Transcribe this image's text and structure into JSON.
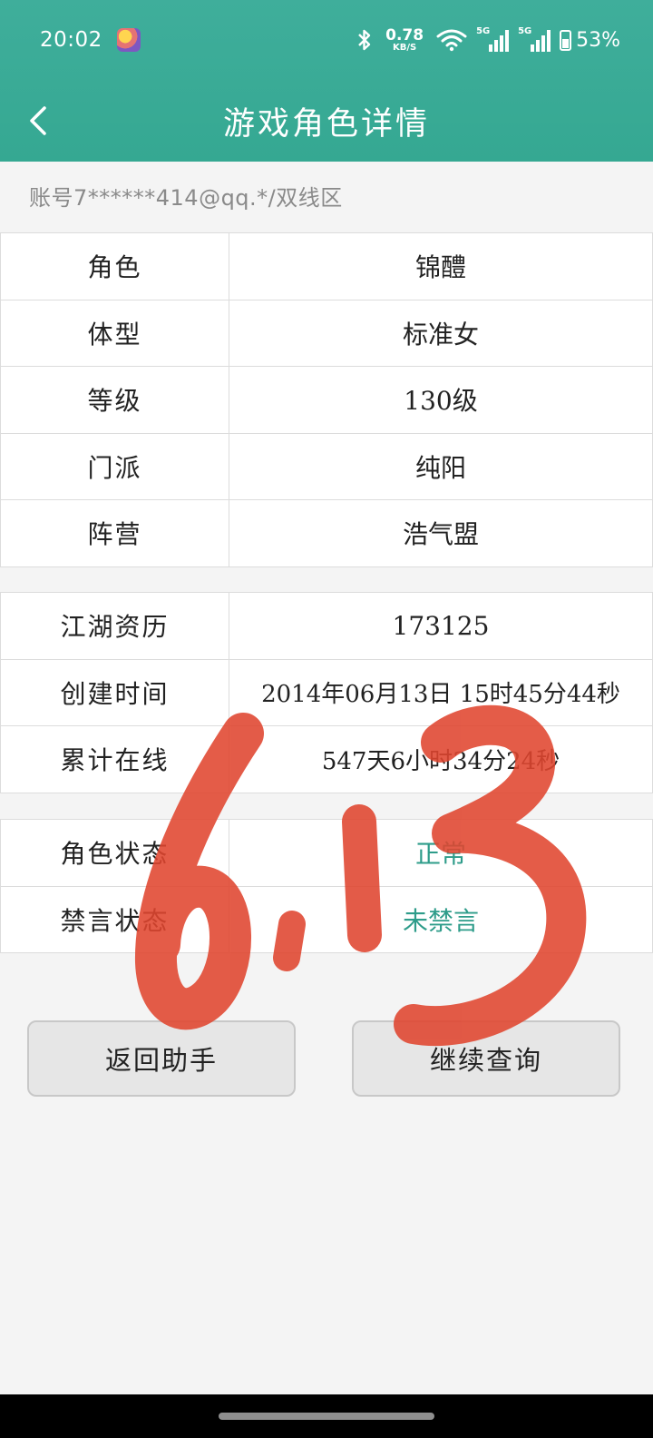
{
  "status_bar": {
    "time": "20:02",
    "speed_value": "0.78",
    "speed_unit": "KB/S",
    "signal1_tag": "5G",
    "signal2_tag": "5G",
    "battery": "53%"
  },
  "nav": {
    "title": "游戏角色详情"
  },
  "account": {
    "line": "账号7******414@qq.*/双线区"
  },
  "basic_info": [
    {
      "label": "角色",
      "value": "锦醴"
    },
    {
      "label": "体型",
      "value": "标准女"
    },
    {
      "label": "等级",
      "value": "130级"
    },
    {
      "label": "门派",
      "value": "纯阳"
    },
    {
      "label": "阵营",
      "value": "浩气盟"
    }
  ],
  "history_info": [
    {
      "label": "江湖资历",
      "value": "173125"
    },
    {
      "label": "创建时间",
      "value": "2014年06月13日 15时45分44秒"
    },
    {
      "label": "累计在线",
      "value": "547天6小时34分24秒"
    }
  ],
  "status_info": [
    {
      "label": "角色状态",
      "value": "正常"
    },
    {
      "label": "禁言状态",
      "value": "未禁言"
    }
  ],
  "buttons": {
    "back_label": "返回助手",
    "continue_label": "继续查询"
  },
  "colors": {
    "header": "#3aab96",
    "status_green": "#2e9c8a",
    "overlay_red": "#e0452f"
  }
}
